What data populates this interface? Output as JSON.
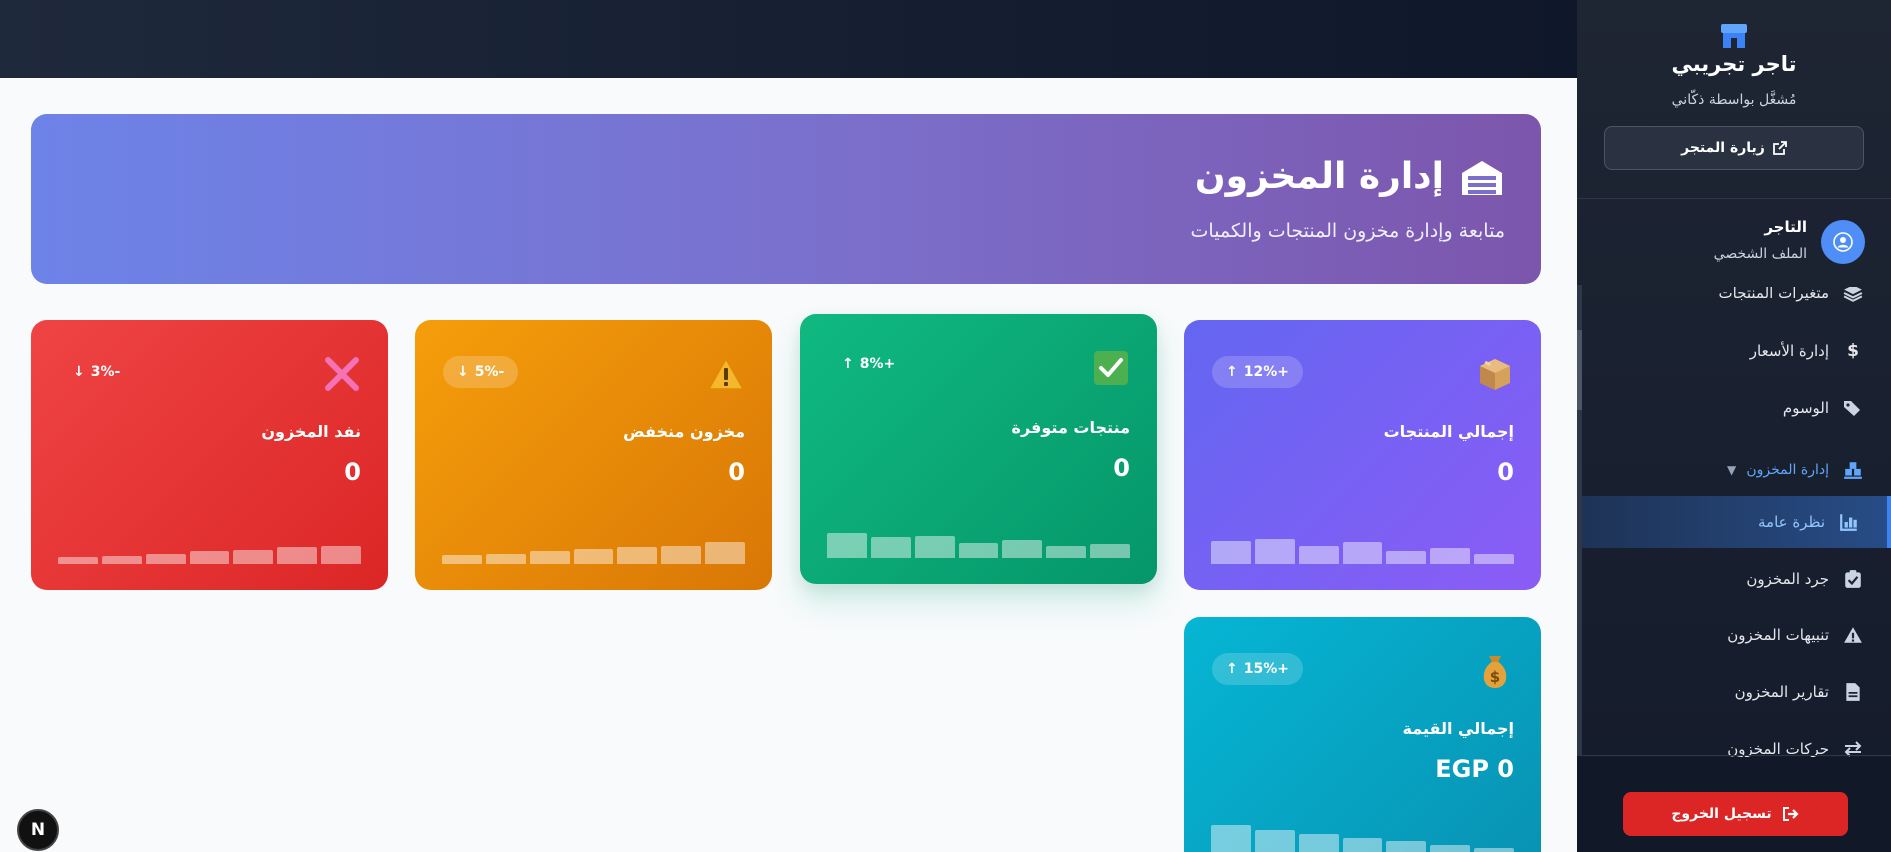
{
  "hero": {
    "title": "إدارة المخزون",
    "subtitle": "متابعة وإدارة مخزون المنتجات والكميات",
    "icon": "warehouse-icon"
  },
  "stats": [
    {
      "key": "total_products",
      "label": "إجمالي المنتجات",
      "value": "0",
      "trend": "12%+",
      "trend_dir": "up",
      "icon": "box-icon",
      "bars": [
        0.55,
        0.6,
        0.42,
        0.52,
        0.3,
        0.38,
        0.25
      ]
    },
    {
      "key": "available",
      "label": "منتجات متوفرة",
      "value": "0",
      "trend": "8%+",
      "trend_dir": "up",
      "icon": "check-icon",
      "bars": [
        0.6,
        0.5,
        0.52,
        0.36,
        0.42,
        0.28,
        0.34
      ]
    },
    {
      "key": "low_stock",
      "label": "مخزون منخفض",
      "value": "0",
      "trend": "5%-",
      "trend_dir": "down",
      "icon": "warning-icon",
      "bars": [
        0.22,
        0.24,
        0.3,
        0.36,
        0.4,
        0.44,
        0.52
      ]
    },
    {
      "key": "out_of_stock",
      "label": "نفد المخزون",
      "value": "0",
      "trend": "3%-",
      "trend_dir": "down",
      "icon": "cross-icon",
      "bars": [
        0.16,
        0.2,
        0.24,
        0.3,
        0.34,
        0.4,
        0.42
      ]
    },
    {
      "key": "total_value",
      "label": "إجمالي القيمة",
      "value": "EGP 0",
      "trend": "15%+",
      "trend_dir": "up",
      "icon": "money-bag-icon",
      "bars": [
        0.85,
        0.75,
        0.65,
        0.55,
        0.48,
        0.38,
        0.3
      ]
    }
  ],
  "sidebar": {
    "store_name": "تاجر تجريبي",
    "store_sub": "مُشغَّل بواسطة ذكّاني",
    "visit_store": "زيارة المتجر",
    "profile_name": "التاجر",
    "profile_sub": "الملف الشخصي",
    "items": [
      {
        "label": "متغيرات المنتجات",
        "icon": "layers-icon"
      },
      {
        "label": "إدارة الأسعار",
        "icon": "dollar-icon"
      },
      {
        "label": "الوسوم",
        "icon": "tags-icon"
      },
      {
        "label": "إدارة المخزون",
        "icon": "inventory-icon"
      },
      {
        "label": "نظرة عامة",
        "icon": "chart-icon"
      },
      {
        "label": "جرد المخزون",
        "icon": "clipboard-icon"
      },
      {
        "label": "تنبيهات المخزون",
        "icon": "alert-icon"
      },
      {
        "label": "تقارير المخزون",
        "icon": "document-icon"
      },
      {
        "label": "حركات المخزون",
        "icon": "transfer-icon"
      }
    ],
    "logout": "تسجيل الخروج"
  },
  "colors": {
    "accent": "#3b82f6",
    "logout": "#dc2626"
  }
}
